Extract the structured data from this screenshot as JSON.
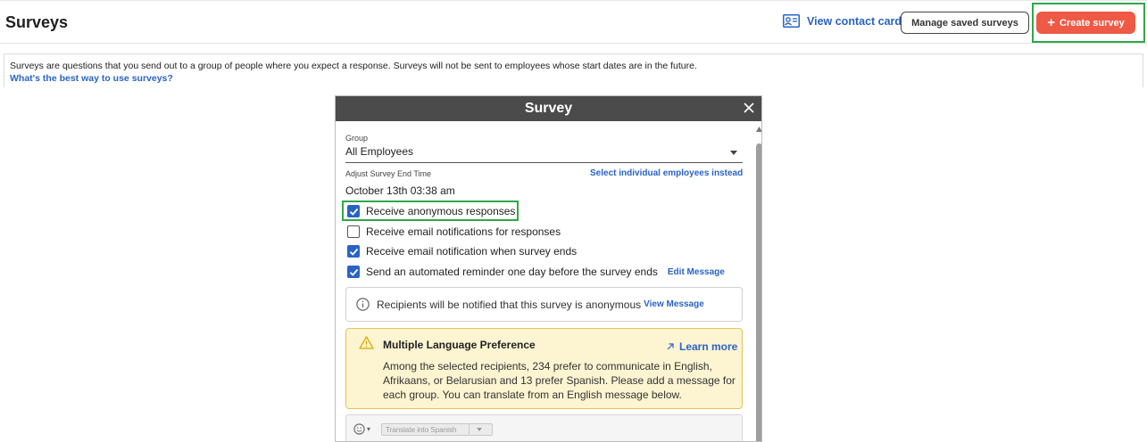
{
  "header": {
    "title": "Surveys",
    "view_contact_card": "View contact card",
    "manage_saved_surveys": "Manage saved surveys",
    "create_survey": "Create survey"
  },
  "info": {
    "description": "Surveys are questions that you send out to a group of people where you expect a response. Surveys will not be sent to employees whose start dates are in the future.",
    "link": "What's the best way to use surveys?"
  },
  "modal": {
    "title": "Survey",
    "group_label": "Group",
    "group_value": "All Employees",
    "end_time_label": "Adjust Survey End Time",
    "select_individual": "Select individual employees instead",
    "end_time_value": "October 13th 03:38 am",
    "options": [
      {
        "label": "Receive anonymous responses",
        "checked": true
      },
      {
        "label": "Receive email notifications for responses",
        "checked": false
      },
      {
        "label": "Receive email notification when survey ends",
        "checked": true
      },
      {
        "label": "Send an automated reminder one day before the survey ends",
        "checked": true
      }
    ],
    "edit_message": "Edit Message",
    "notice_text": "Recipients will be notified that this survey is anonymous",
    "view_message": "View Message",
    "warning": {
      "title": "Multiple Language Preference",
      "learn_more": "Learn more",
      "text": "Among the selected recipients, 234 prefer to communicate in English, Afrikaans, or Belarusian and 13 prefer Spanish. Please add a message for each group. You can translate from an English message below."
    },
    "translate_button": "Translate into Spanish"
  },
  "colors": {
    "accent": "#2a63c7",
    "create_button": "#ee5a45",
    "highlight": "#2ea84a",
    "modal_header": "#4b4b4b",
    "warning_bg": "#fdf4d1"
  }
}
